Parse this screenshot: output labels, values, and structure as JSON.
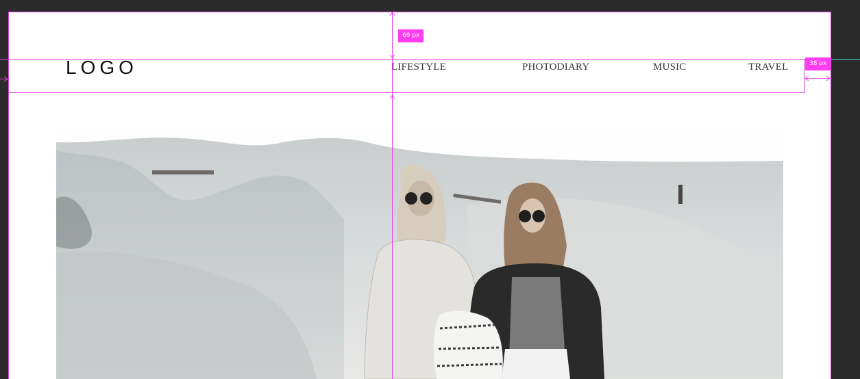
{
  "header": {
    "logo_text": "LOGO",
    "nav": [
      {
        "label": "LIFESTYLE"
      },
      {
        "label": "PHOTODIARY"
      },
      {
        "label": "MUSIC"
      },
      {
        "label": "TRAVEL"
      }
    ]
  },
  "guides": {
    "top_margin_label": "69 px",
    "right_margin_label": "38 px"
  },
  "colors": {
    "canvas_background": "#2b2b2b",
    "guide": "#e040e0",
    "badge": "#ff3df0",
    "artboard": "#ffffff"
  }
}
